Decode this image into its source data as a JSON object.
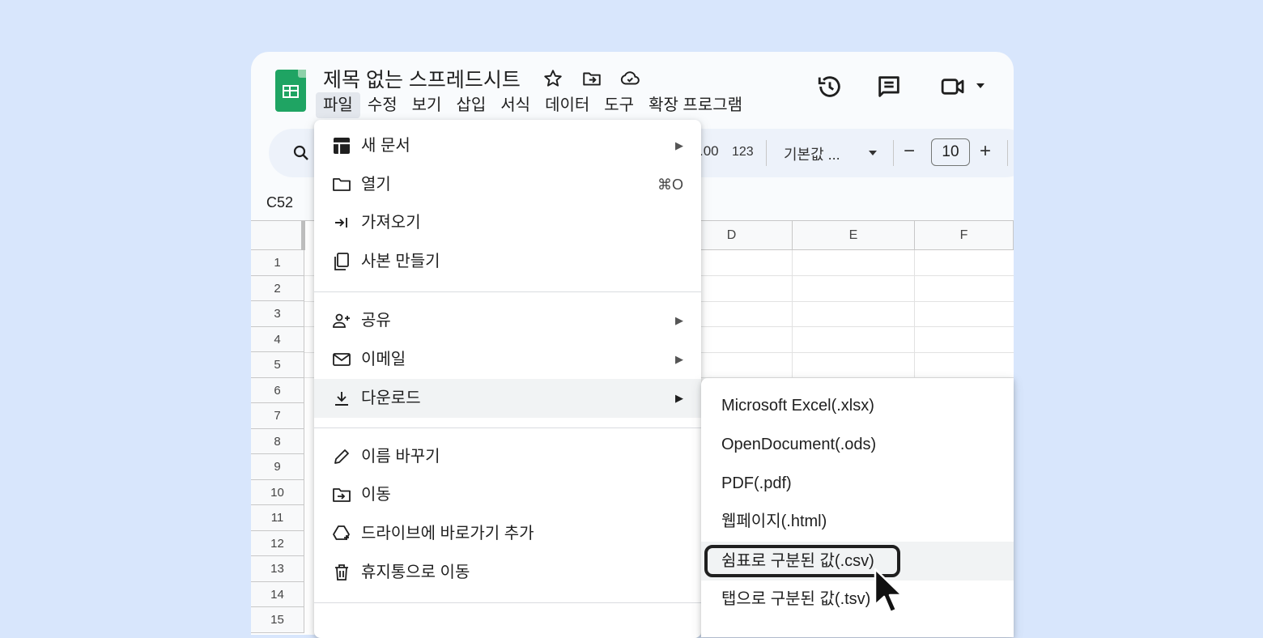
{
  "document": {
    "title": "제목 없는 스프레드시트"
  },
  "menubar": {
    "items": [
      "파일",
      "수정",
      "보기",
      "삽입",
      "서식",
      "데이터",
      "도구",
      "확장 프로그램"
    ]
  },
  "toolbar": {
    "decimal_label": ".00",
    "format_123": "123",
    "font_label": "기본값 ...",
    "font_size": "10",
    "minus": "−",
    "plus": "+"
  },
  "cell_ref": "C52",
  "columns": [
    "D",
    "E",
    "F"
  ],
  "rows": [
    "1",
    "2",
    "3",
    "4",
    "5",
    "6",
    "7",
    "8",
    "9",
    "10",
    "11",
    "12",
    "13",
    "14",
    "15"
  ],
  "file_menu": {
    "items": [
      {
        "label": "새 문서",
        "icon": "new-sheet-icon",
        "arrow": "▶"
      },
      {
        "label": "열기",
        "icon": "folder-icon",
        "shortcut": "⌘O"
      },
      {
        "label": "가져오기",
        "icon": "import-icon"
      },
      {
        "label": "사본 만들기",
        "icon": "copy-icon"
      },
      {
        "label": "공유",
        "icon": "share-person-icon",
        "arrow": "▶"
      },
      {
        "label": "이메일",
        "icon": "mail-icon",
        "arrow": "▶"
      },
      {
        "label": "다운로드",
        "icon": "download-icon",
        "arrow": "▶"
      },
      {
        "label": "이름 바꾸기",
        "icon": "pencil-icon"
      },
      {
        "label": "이동",
        "icon": "move-folder-icon"
      },
      {
        "label": "드라이브에 바로가기 추가",
        "icon": "drive-shortcut-icon"
      },
      {
        "label": "휴지통으로 이동",
        "icon": "trash-icon"
      }
    ]
  },
  "download_submenu": {
    "items": [
      "Microsoft Excel(.xlsx)",
      "OpenDocument(.ods)",
      "PDF(.pdf)",
      "웹페이지(.html)",
      "쉼표로 구분된 값(.csv)",
      "탭으로 구분된 값(.tsv)"
    ]
  }
}
